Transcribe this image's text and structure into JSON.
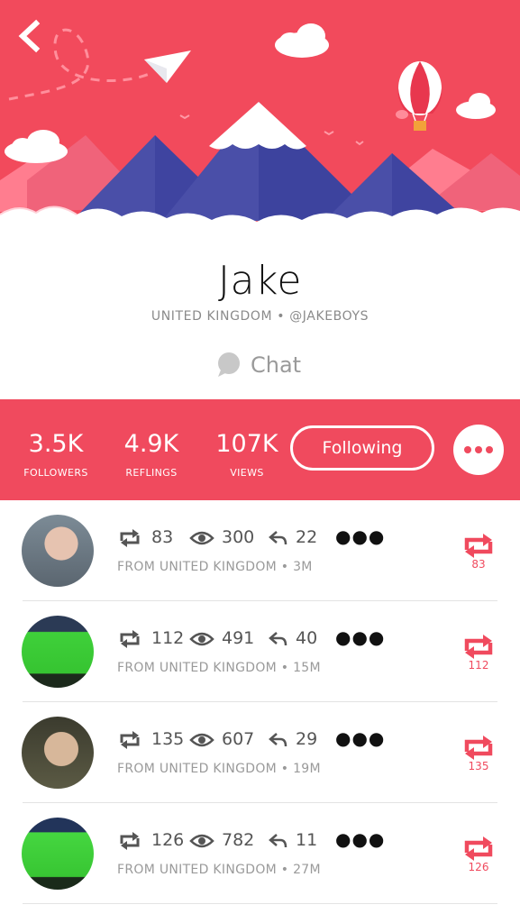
{
  "header": {
    "back_icon": "chevron-left-icon",
    "colors": {
      "sky": "#f24a5c",
      "mountain": "#4a4fa8",
      "snow": "#ffffff"
    }
  },
  "profile": {
    "name": "Jake",
    "meta": "UNITED KINGDOM • @JAKEBOYS",
    "chat_label": "Chat"
  },
  "stats": {
    "followers": {
      "value": "3.5K",
      "label": "FOLLOWERS"
    },
    "reflings": {
      "value": "4.9K",
      "label": "REFLINGS"
    },
    "views": {
      "value": "107K",
      "label": "VIEWS"
    },
    "following_label": "Following",
    "accent": "#f04a5e"
  },
  "feed": [
    {
      "reflings": "83",
      "views": "300",
      "replies": "22",
      "origin": "FROM UNITED KINGDOM • 3M",
      "refling_count": "83"
    },
    {
      "reflings": "112",
      "views": "491",
      "replies": "40",
      "origin": "FROM UNITED KINGDOM • 15M",
      "refling_count": "112"
    },
    {
      "reflings": "135",
      "views": "607",
      "replies": "29",
      "origin": "FROM UNITED KINGDOM • 19M",
      "refling_count": "135"
    },
    {
      "reflings": "126",
      "views": "782",
      "replies": "11",
      "origin": "FROM UNITED KINGDOM • 27M",
      "refling_count": "126"
    }
  ]
}
